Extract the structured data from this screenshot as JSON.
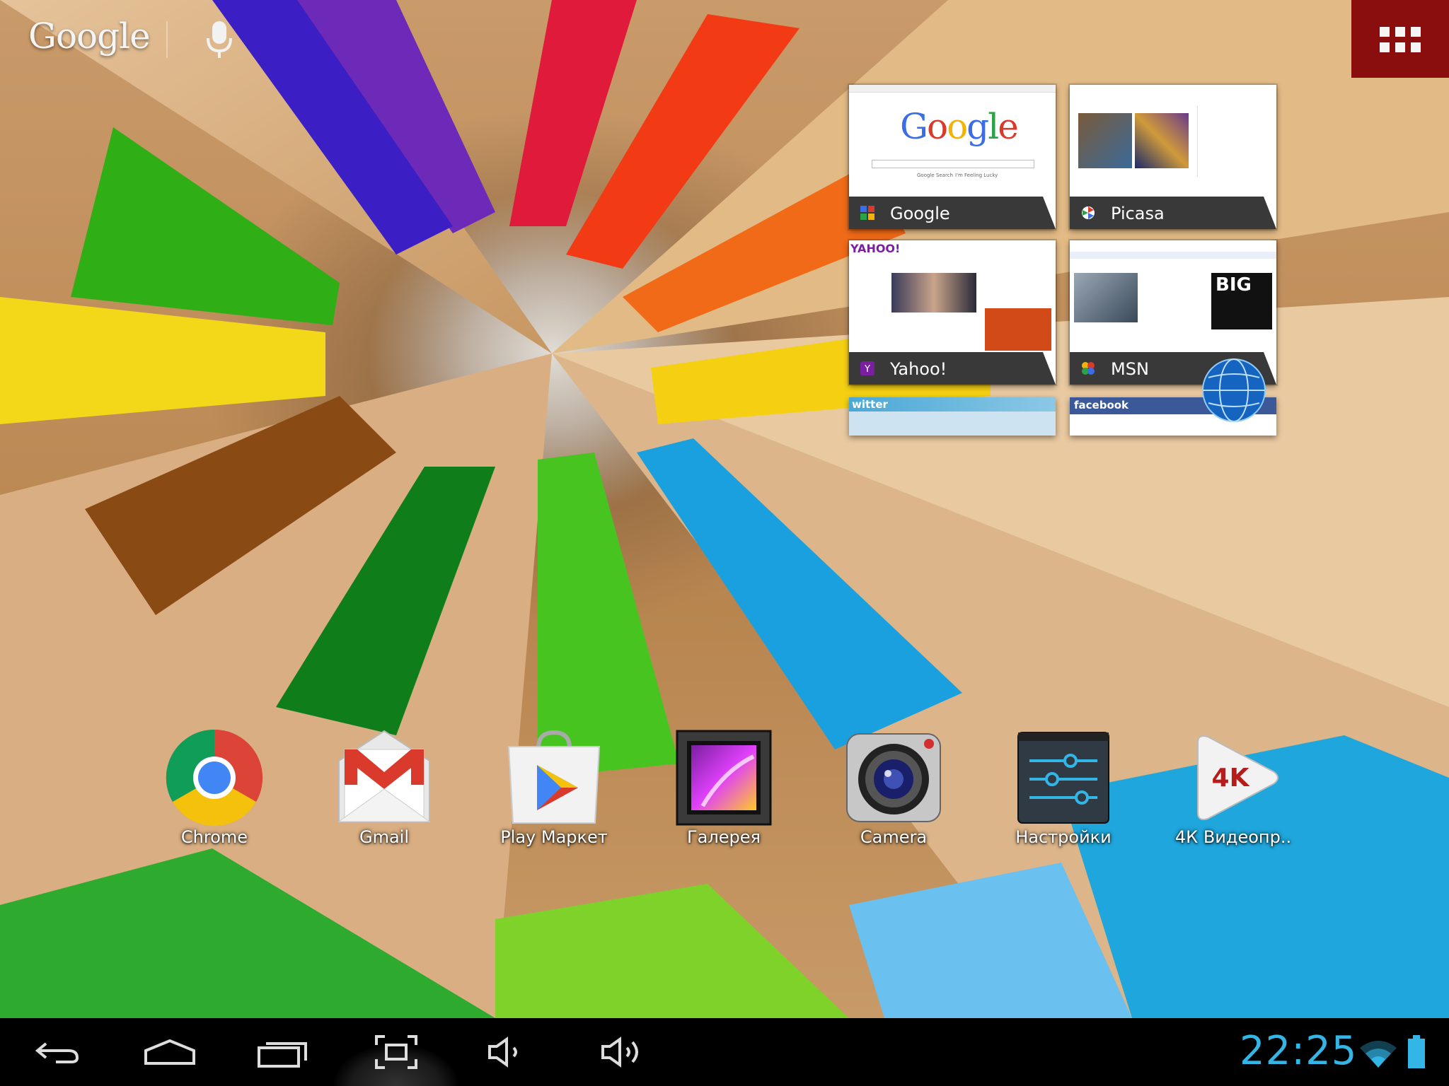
{
  "search": {
    "logo_text": "Google",
    "mic_icon": "microphone-icon"
  },
  "all_apps": {
    "icon": "grid-icon"
  },
  "bookmarks": [
    {
      "label": "Google",
      "favicon": "google-favicon"
    },
    {
      "label": "Picasa",
      "favicon": "picasa-favicon"
    },
    {
      "label": "Yahoo!",
      "favicon": "yahoo-favicon"
    },
    {
      "label": "MSN",
      "favicon": "msn-favicon"
    }
  ],
  "bookmarks_partial": [
    "witter",
    "facebook"
  ],
  "thumbs": {
    "google_logo": "Google",
    "google_search_btn": "Google Search",
    "google_lucky_btn": "I'm Feeling Lucky",
    "yahoo_logo": "YAHOO!",
    "msn_big": "BIG"
  },
  "apps": [
    {
      "label": "Chrome",
      "icon": "chrome-icon"
    },
    {
      "label": "Gmail",
      "icon": "gmail-icon"
    },
    {
      "label": "Play Маркет",
      "icon": "play-store-icon"
    },
    {
      "label": "Галерея",
      "icon": "gallery-icon"
    },
    {
      "label": "Camera",
      "icon": "camera-icon"
    },
    {
      "label": "Настройки",
      "icon": "settings-icon"
    },
    {
      "label": "4К Видеопр..",
      "icon": "4k-video-icon"
    }
  ],
  "app_4k_badge": "4K",
  "system_bar": {
    "clock": "22:25",
    "nav": [
      "back-icon",
      "home-icon",
      "recent-apps-icon",
      "screenshot-icon",
      "volume-down-icon",
      "volume-up-icon"
    ],
    "accent": "#33b5e5"
  }
}
